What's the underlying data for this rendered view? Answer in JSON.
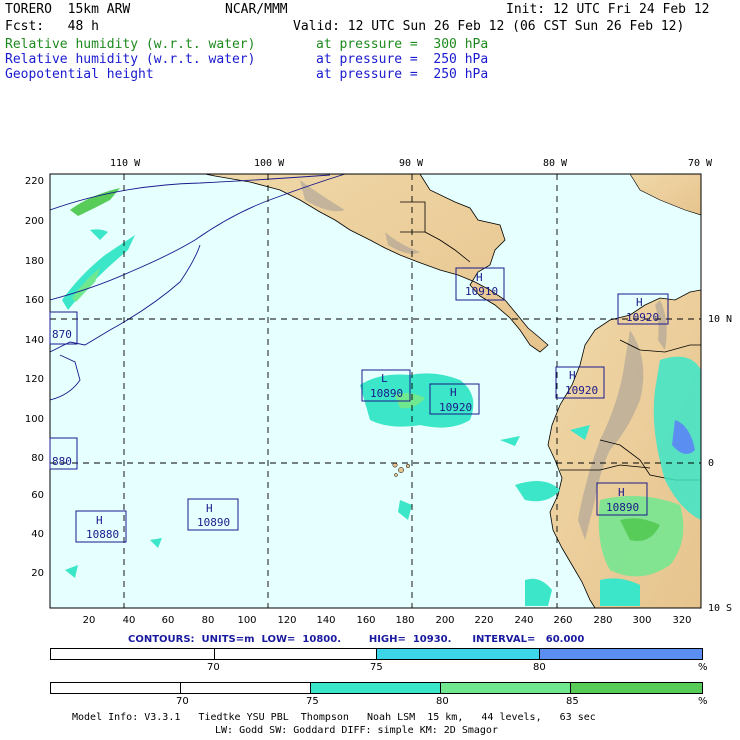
{
  "header": {
    "model": "TORERO  15km ARW",
    "org": "NCAR/MMM",
    "init": "Init: 12 UTC Fri 24 Feb 12",
    "fcst": "Fcst:   48 h",
    "valid": "Valid: 12 UTC Sun 26 Feb 12 (06 CST Sun 26 Feb 12)",
    "fields": [
      {
        "name": "Relative humidity (w.r.t. water)",
        "level": "at pressure =  300 hPa",
        "color": "#1e8a1e"
      },
      {
        "name": "Relative humidity (w.r.t. water)",
        "level": "at pressure =  250 hPa",
        "color": "#1a1ad0"
      },
      {
        "name": "Geopotential height",
        "level": "at pressure =  250 hPa",
        "color": "#1a1ad0"
      }
    ]
  },
  "map": {
    "top_labels": [
      "110 W",
      "100 W",
      "90 W",
      "80 W",
      "70 W"
    ],
    "right_labels": [
      "10 N",
      "0",
      "10 S"
    ],
    "y_ticks": [
      "220",
      "200",
      "180",
      "160",
      "140",
      "120",
      "100",
      "80",
      "60",
      "40",
      "20"
    ],
    "x_ticks": [
      "20",
      "40",
      "60",
      "80",
      "100",
      "120",
      "140",
      "160",
      "180",
      "200",
      "220",
      "240",
      "260",
      "280",
      "300",
      "320"
    ],
    "centers": [
      {
        "type": "H",
        "value": "10910"
      },
      {
        "type": "H",
        "value": "10920"
      },
      {
        "type": "L",
        "value": "10890"
      },
      {
        "type": "H",
        "value": "10920"
      },
      {
        "type": "H",
        "value": "10920"
      },
      {
        "type": "H",
        "value": "10890"
      },
      {
        "type": "H",
        "value": "10880"
      },
      {
        "type": "H",
        "value": "10890"
      },
      {
        "type": "",
        "value": "870"
      },
      {
        "type": "",
        "value": "880"
      }
    ]
  },
  "contours": "CONTOURS:  UNITS=m  LOW=  10800.        HIGH=  10930.      INTERVAL=   60.000",
  "colorbar1": {
    "segments": [
      {
        "color": "#ffffff"
      },
      {
        "color": "#ffffff"
      },
      {
        "color": "#3cd6e8"
      },
      {
        "color": "#5a8ef0"
      }
    ],
    "labels": [
      "70",
      "75",
      "80",
      "%"
    ]
  },
  "colorbar2": {
    "segments": [
      {
        "color": "#ffffff"
      },
      {
        "color": "#ffffff"
      },
      {
        "color": "#3ce6c8"
      },
      {
        "color": "#70e890"
      },
      {
        "color": "#58cc58"
      }
    ],
    "labels": [
      "70",
      "75",
      "80",
      "85",
      "%"
    ]
  },
  "footer": [
    "Model Info: V3.3.1   Tiedtke YSU PBL  Thompson   Noah LSM  15 km,   44 levels,   63 sec",
    "LW: Godd SW: Goddard DIFF: simple KM: 2D Smagor"
  ]
}
